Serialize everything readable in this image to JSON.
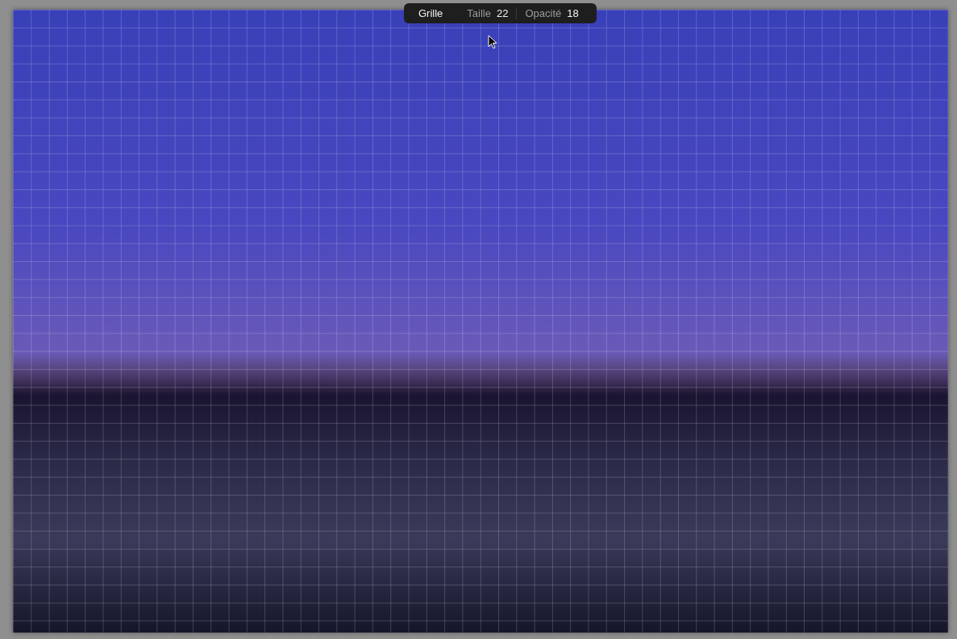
{
  "overlay_toolbar": {
    "title": "Grille",
    "settings": [
      {
        "label": "Taille",
        "value": "22"
      },
      {
        "label": "Opacité",
        "value": "18"
      }
    ]
  }
}
